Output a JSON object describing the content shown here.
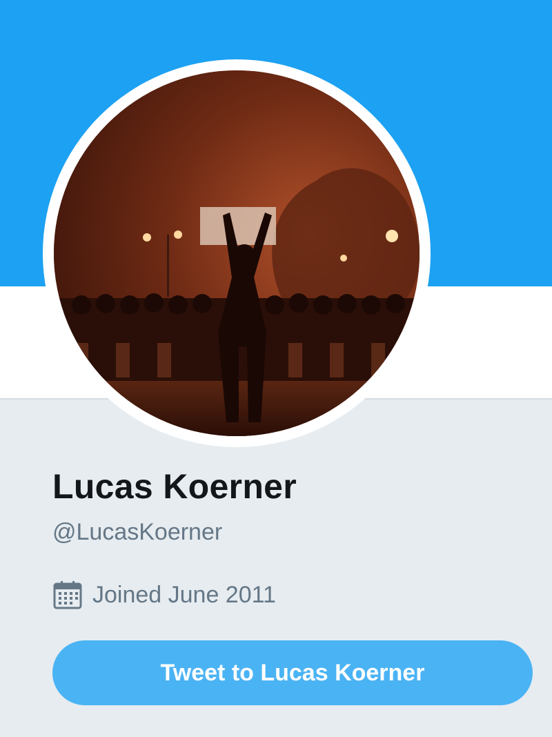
{
  "profile": {
    "display_name": "Lucas Koerner",
    "handle": "@LucasKoerner",
    "joined": "Joined June 2011",
    "tweet_button_label": "Tweet to Lucas Koerner"
  },
  "icons": {
    "joined": "calendar-icon"
  },
  "colors": {
    "banner": "#1da1f2",
    "button": "#4ab3f4",
    "background": "#e6ecf0",
    "name_text": "#14171a",
    "secondary_text": "#657786"
  }
}
